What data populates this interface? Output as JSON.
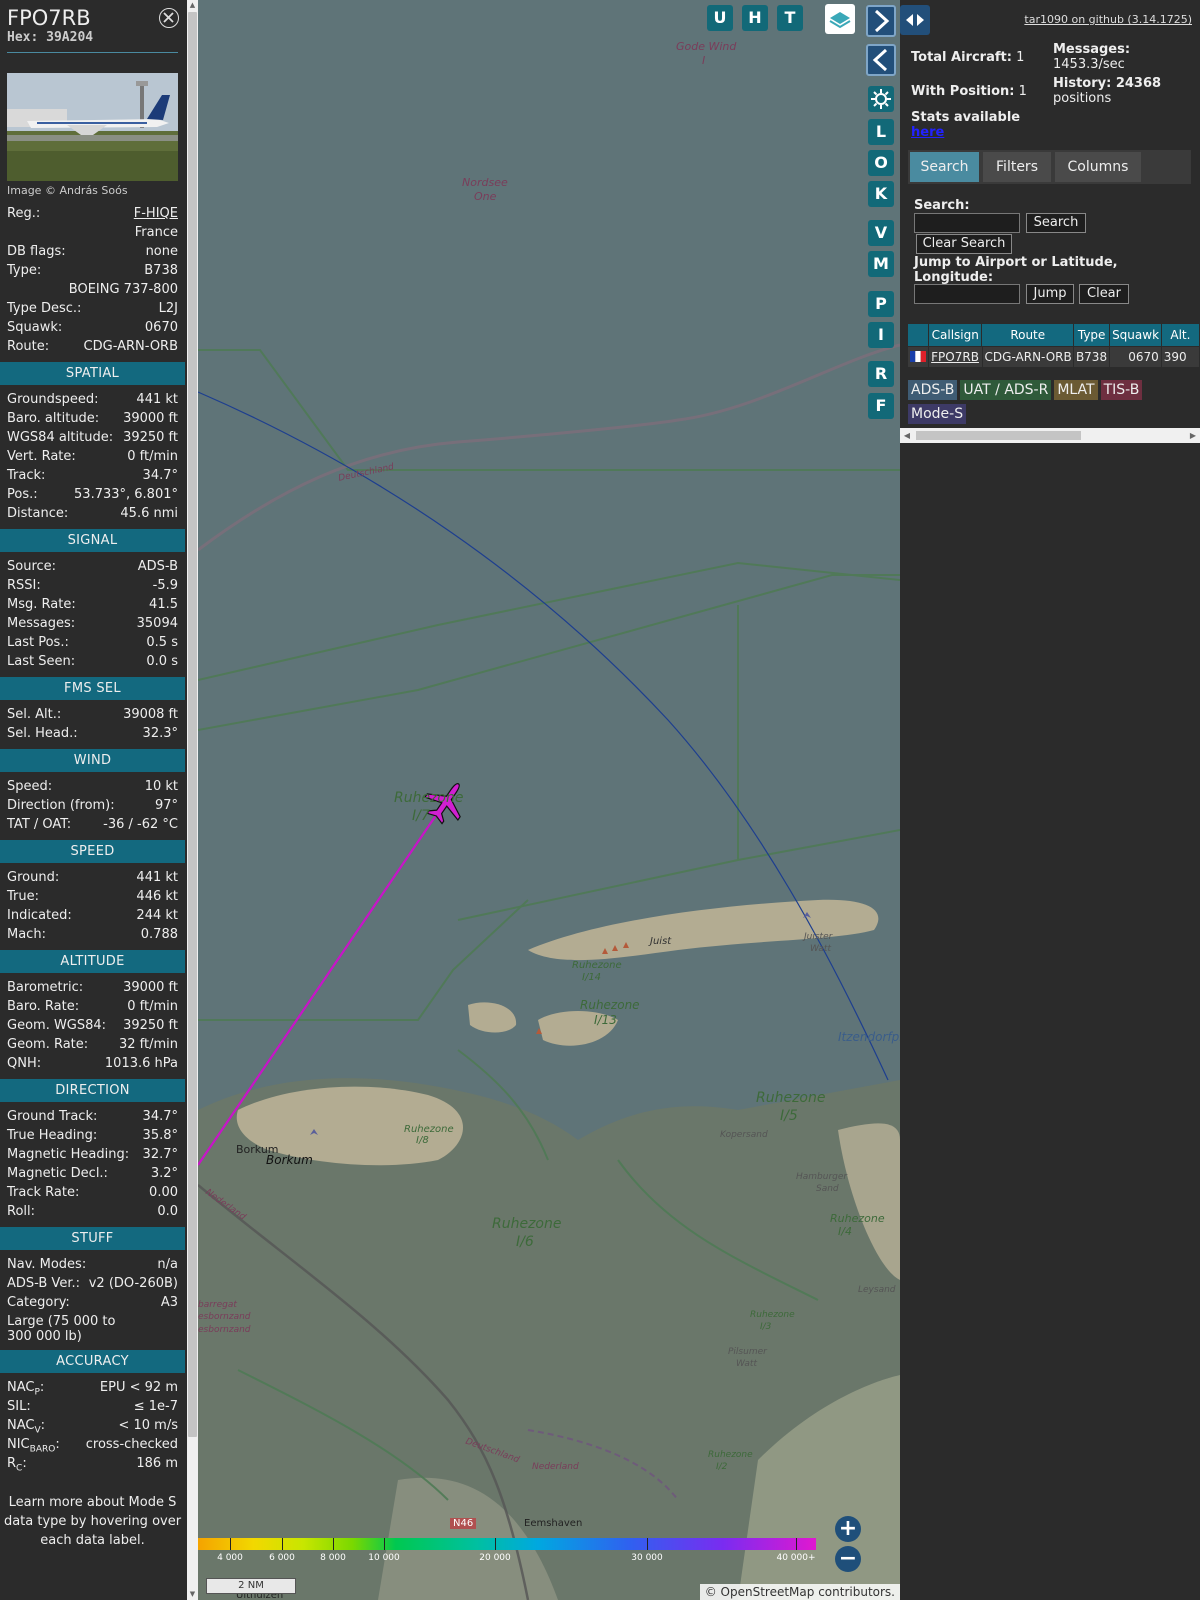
{
  "sidebar": {
    "callsign": "FPO7RB",
    "hex": "Hex: 39A204",
    "photo_credit": "Image © András Soós",
    "basic": [
      {
        "label": "Reg.:",
        "value": "F-HIQE",
        "link": true
      },
      {
        "label": "",
        "value": "France"
      },
      {
        "label": "DB flags:",
        "value": "none"
      },
      {
        "label": "Type:",
        "value": "B738"
      },
      {
        "label": "",
        "value": "BOEING 737-800"
      },
      {
        "label": "Type Desc.:",
        "value": "L2J"
      },
      {
        "label": "Squawk:",
        "value": "0670"
      },
      {
        "label": "Route:",
        "value": "CDG-ARN-ORB"
      }
    ],
    "sections": [
      {
        "title": "SPATIAL",
        "rows": [
          {
            "label": "Groundspeed:",
            "value": "441 kt"
          },
          {
            "label": "Baro. altitude:",
            "value": "39000 ft"
          },
          {
            "label": "WGS84 altitude:",
            "value": "39250 ft"
          },
          {
            "label": "Vert. Rate:",
            "value": "0 ft/min"
          },
          {
            "label": "Track:",
            "value": "34.7°"
          },
          {
            "label": "Pos.:",
            "value": "53.733°, 6.801°"
          },
          {
            "label": "Distance:",
            "value": "45.6 nmi"
          }
        ]
      },
      {
        "title": "SIGNAL",
        "rows": [
          {
            "label": "Source:",
            "value": "ADS-B"
          },
          {
            "label": "RSSI:",
            "value": "-5.9"
          },
          {
            "label": "Msg. Rate:",
            "value": "41.5"
          },
          {
            "label": "Messages:",
            "value": "35094"
          },
          {
            "label": "Last Pos.:",
            "value": "0.5 s"
          },
          {
            "label": "Last Seen:",
            "value": "0.0 s"
          }
        ]
      },
      {
        "title": "FMS SEL",
        "rows": [
          {
            "label": "Sel. Alt.:",
            "value": "39008 ft"
          },
          {
            "label": "Sel. Head.:",
            "value": "32.3°"
          }
        ]
      },
      {
        "title": "WIND",
        "rows": [
          {
            "label": "Speed:",
            "value": "10 kt"
          },
          {
            "label": "Direction (from):",
            "value": "97°"
          },
          {
            "label": "TAT / OAT:",
            "value": "-36 / -62 °C"
          }
        ]
      },
      {
        "title": "SPEED",
        "rows": [
          {
            "label": "Ground:",
            "value": "441 kt"
          },
          {
            "label": "True:",
            "value": "446 kt"
          },
          {
            "label": "Indicated:",
            "value": "244 kt"
          },
          {
            "label": "Mach:",
            "value": "0.788"
          }
        ]
      },
      {
        "title": "ALTITUDE",
        "rows": [
          {
            "label": "Barometric:",
            "value": "39000 ft"
          },
          {
            "label": "Baro. Rate:",
            "value": "0 ft/min"
          },
          {
            "label": "Geom. WGS84:",
            "value": "39250 ft"
          },
          {
            "label": "Geom. Rate:",
            "value": "32 ft/min"
          },
          {
            "label": "QNH:",
            "value": "1013.6 hPa"
          }
        ]
      },
      {
        "title": "DIRECTION",
        "rows": [
          {
            "label": "Ground Track:",
            "value": "34.7°"
          },
          {
            "label": "True Heading:",
            "value": "35.8°"
          },
          {
            "label": "Magnetic Heading:",
            "value": "32.7°"
          },
          {
            "label": "Magnetic Decl.:",
            "value": "3.2°"
          },
          {
            "label": "Track Rate:",
            "value": "0.00"
          },
          {
            "label": "Roll:",
            "value": "0.0"
          }
        ]
      },
      {
        "title": "STUFF",
        "rows": [
          {
            "label": "Nav. Modes:",
            "value": "n/a"
          },
          {
            "label": "ADS-B Ver.:",
            "value": "v2 (DO-260B)"
          },
          {
            "label": "Category:",
            "value": "A3"
          }
        ],
        "extra": "Large (75 000 to 300 000 lb)"
      },
      {
        "title": "ACCURACY",
        "rows": [
          {
            "label": "NAC",
            "sub": "P",
            "value": "EPU < 92 m"
          },
          {
            "label": "SIL:",
            "value": "≤ 1e-7"
          },
          {
            "label": "NAC",
            "sub": "V",
            "value": "< 10 m/s"
          },
          {
            "label": "NIC",
            "sub": "BARO",
            "value": "cross-checked"
          },
          {
            "label": "R",
            "sub": "C",
            "value": "186 m"
          }
        ]
      }
    ],
    "footnote": "Learn more about Mode S data type by hovering over each data label."
  },
  "map": {
    "buttons_top": [
      "U",
      "H",
      "T"
    ],
    "buttons_side": [
      "L",
      "O",
      "K",
      "V",
      "M",
      "P",
      "I",
      "R",
      "F"
    ],
    "labels": {
      "gode_wind": "Gode Wind",
      "gode_wind_num": "I",
      "nordsee": "Nordsee",
      "nordsee_one": "One",
      "deutschland_top": "Deutschland",
      "ruhezone_plane": "Ruhezone",
      "ruhezone_plane_num": "I/7",
      "juist": "Juist",
      "juister": "Juister",
      "juister_watt": "Watt",
      "rz14": "Ruhezone",
      "rz14n": "I/14",
      "rz13": "Ruhezone",
      "rz13n": "I/13",
      "itzendorf": "Itzendorfpl",
      "rz15": "Ruhezone",
      "rz15n": "I/5",
      "kopersand": "Kopersand",
      "borkum1": "Borkum",
      "borkum2": "Borkum",
      "rz18": "Ruhezone",
      "rz18n": "I/8",
      "hamburger": "Hamburger",
      "sand": "Sand",
      "rz14b": "Ruhezone",
      "rz14bn": "I/4",
      "nederland_left": "Nederland",
      "rz16": "Ruhezone",
      "rz16n": "I/6",
      "leysand": "Leysand",
      "barregat": "barregat",
      "esbornzand": "esbornzand",
      "esbornzand2": "esbornzand",
      "rz13b": "Ruhezone",
      "rz13bn": "I/3",
      "pilsumer": "Pilsumer",
      "watt": "Watt",
      "deutschland_bottom": "Deutschland",
      "nederland_bottom": "Nederland",
      "rz12": "Ruhezone",
      "rz12n": "I/2",
      "n46": "N46",
      "eemshaven": "Eemshaven",
      "uithuizen": "Uithuizen"
    },
    "altitude_scale": [
      "4 000",
      "6 000",
      "8 000",
      "10 000",
      "20 000",
      "30 000",
      "40 000+"
    ],
    "scale_bar": "2 NM",
    "attribution_prefix": "©",
    "attribution_link": "OpenStreetMap",
    "attribution_suffix": "contributors.",
    "colors": {
      "sea": "#5f7478",
      "land": "#b3ac92",
      "track": "#c814c8",
      "plane": "#d020d0"
    }
  },
  "right": {
    "github": "tar1090 on github (3.14.1725)",
    "total_aircraft_label": "Total Aircraft:",
    "total_aircraft": "1",
    "with_position_label": "With Position:",
    "with_position": "1",
    "stats_label": "Stats available",
    "stats_link": "here",
    "messages_label": "Messages:",
    "messages_value": "1453.3/sec",
    "history_label": "History: 24368",
    "history_value": "positions",
    "tabs": [
      "Search",
      "Filters",
      "Columns"
    ],
    "search_label": "Search:",
    "search_button": "Search",
    "clear_search_button": "Clear Search",
    "jump_label": "Jump to Airport or Latitude, Longitude:",
    "jump_button": "Jump",
    "clear_button": "Clear",
    "table": {
      "headers": [
        "",
        "Callsign",
        "Route",
        "Type",
        "Squawk",
        "Alt."
      ],
      "rows": [
        {
          "flag": "france-flag-icon",
          "callsign": "FPO7RB",
          "route": "CDG-ARN-ORB",
          "type": "B738",
          "squawk": "0670",
          "alt": "390"
        }
      ]
    },
    "badges": [
      {
        "label": "ADS-B",
        "bg": "#3f5c74"
      },
      {
        "label": "UAT / ADS-R",
        "bg": "#2f5a3a"
      },
      {
        "label": "MLAT",
        "bg": "#6b5a33"
      },
      {
        "label": "TIS-B",
        "bg": "#6e2f40"
      },
      {
        "label": "Mode-S",
        "bg": "#3d3a66"
      }
    ]
  }
}
